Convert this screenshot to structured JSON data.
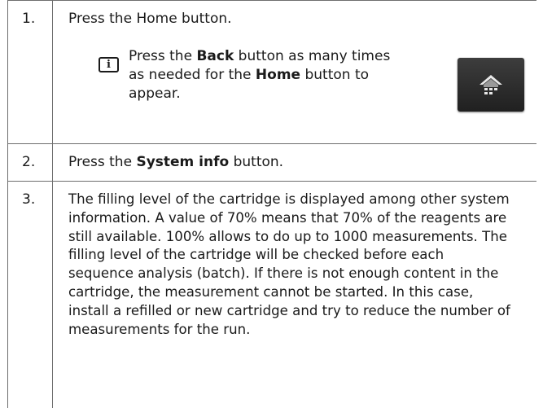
{
  "steps": [
    {
      "number": "1.",
      "text": "Press the Home button.",
      "note": {
        "parts": [
          {
            "text": "Press the ",
            "bold": false
          },
          {
            "text": "Back",
            "bold": true
          },
          {
            "text": " button as many times as needed for the ",
            "bold": false
          },
          {
            "text": "Home",
            "bold": true
          },
          {
            "text": " button to appear.",
            "bold": false
          }
        ],
        "icon": "info-icon",
        "icon_glyph": "i",
        "image_icon": "home-button-icon"
      }
    },
    {
      "number": "2.",
      "parts": [
        {
          "text": "Press the ",
          "bold": false
        },
        {
          "text": "System info",
          "bold": true
        },
        {
          "text": " button.",
          "bold": false
        }
      ]
    },
    {
      "number": "3.",
      "text": "The filling level of the cartridge is displayed among other system information. A value of 70% means that 70% of the reagents are still available. 100% allows to do up to 1000 measurements. The filling level of the cartridge will be checked before each sequence analysis (batch). If there is not enough content in the cartridge, the measurement cannot be started. In this case, install a refilled or new cartridge and try to reduce the number of measurements for the run."
    }
  ],
  "colors": {
    "border": "#6e6e6e",
    "text": "#1a1a1a",
    "button_bg": "#2a2a2a",
    "icon_light": "#e8e8e8"
  }
}
